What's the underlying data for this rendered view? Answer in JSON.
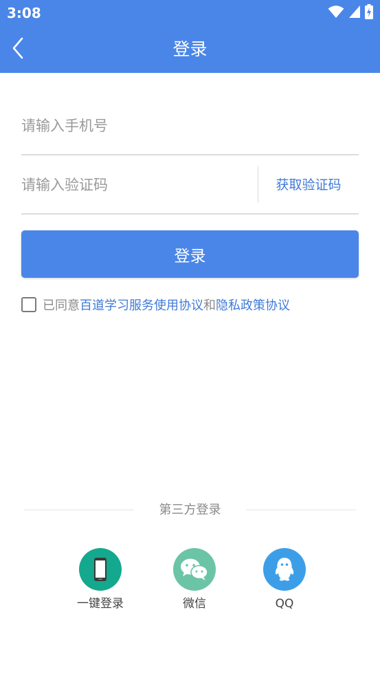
{
  "status_bar": {
    "time": "3:08",
    "icons": [
      "wifi-icon",
      "signal-icon",
      "battery-icon"
    ]
  },
  "header": {
    "title": "登录",
    "back_icon": "back-arrow-icon"
  },
  "form": {
    "phone_placeholder": "请输入手机号",
    "phone_value": "",
    "code_placeholder": "请输入验证码",
    "code_value": "",
    "get_code_label": "获取验证码",
    "login_label": "登录"
  },
  "agreement": {
    "prefix": "已同意",
    "terms_link": "百道学习服务使用协议",
    "and": "和",
    "privacy_link": "隐私政策协议",
    "checked": false
  },
  "third_party": {
    "title": "第三方登录",
    "items": [
      {
        "label": "一键登录",
        "icon": "phone-icon",
        "color": "#14a88e"
      },
      {
        "label": "微信",
        "icon": "wechat-icon",
        "color": "#6cc4a6"
      },
      {
        "label": "QQ",
        "icon": "qq-icon",
        "color": "#3d9ee8"
      }
    ]
  },
  "colors": {
    "primary": "#4a86e8",
    "link": "#3f7ad8"
  }
}
